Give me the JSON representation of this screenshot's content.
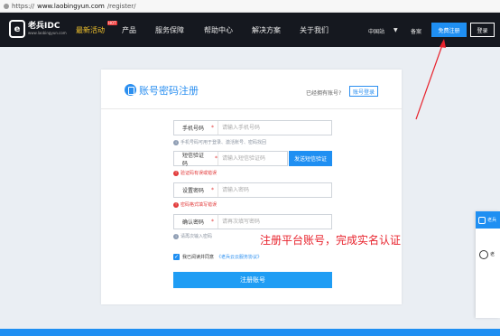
{
  "browser": {
    "url_scheme": "https://",
    "url_host": "www.laobingyun.com",
    "url_path": "/register/"
  },
  "nav": {
    "logo_mark": "e",
    "logo_name": "老兵IDC",
    "logo_sub": "www.laobingyun.com",
    "items": [
      "最新活动",
      "产品",
      "服务保障",
      "帮助中心",
      "解决方案",
      "关于我们"
    ],
    "hot_badge": "HOT",
    "region": "中国站",
    "beian": "备案",
    "free_register": "免费注册",
    "login": "登录"
  },
  "form": {
    "title": "账号密码注册",
    "has_account": "已经拥有账号?",
    "login_button": "账号登录",
    "fields": {
      "phone": {
        "label": "手机号码",
        "placeholder": "请输入手机号码"
      },
      "sms": {
        "label": "短信验证码",
        "placeholder": "请输入短信验证码"
      },
      "password": {
        "label": "设置密码",
        "placeholder": "请输入密码"
      },
      "confirm": {
        "label": "确认密码",
        "placeholder": "请再次填写密码"
      }
    },
    "required_mark": "*",
    "hints": {
      "phone": "手机号码可用于登录、激活账号、密码找回",
      "sms_error": "验证码有误或错误",
      "password_error": "密码格式填写错误",
      "confirm": "请再次输入密码"
    },
    "sms_button": "发送短信验证",
    "agree_text": "我已阅读并同意",
    "agree_link": "《老兵云云服务协议》",
    "checkbox_mark": "✓",
    "submit": "注册账号"
  },
  "annotation": "注册平台账号，完成实名认证",
  "side_widget": {
    "title": "老兵",
    "text": "老"
  },
  "colors": {
    "nav_bg": "#15181f",
    "accent": "#1f8ff2",
    "error": "#e23b3b",
    "annotation": "#e8222c",
    "active_nav": "#f7c72c"
  }
}
